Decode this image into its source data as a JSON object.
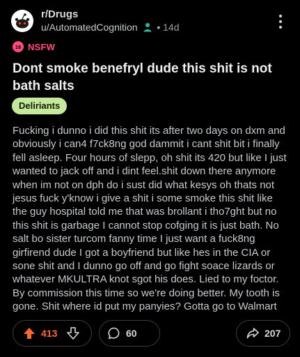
{
  "post": {
    "subreddit": "r/Drugs",
    "author": "u/AutomatedCognition",
    "age": "14d",
    "separator": "•",
    "nsfw_label": "NSFW",
    "title": "Dont smoke benefryl dude this shit is not bath salts",
    "flair": "Deliriants",
    "body": "Fucking i dunno i did this shit its after two days on dxm and obviously i can4 f7ck8ng god dammit i cant shit bit i finally fell asleep. Four hours of slepp, oh shit its 420 but like I just wanted to jack off and i dint feel.shit down there anymore when im not on dph do i sust did what kesys oh thats not jesus fuck y'know i give a shit i some smoke this shit like the guy hospital told me that was brollant i tho7ght but no this shit is garbage I cannot stop cofging it is just bath. No salt bo sister turcom fanny time I just want a fuck8ng girfirend dude I got a boyfriend but like hes in the CIA or sone shit and I dunno go off and go fight soace lizards or whatever MKULTRA knot sgot his does. Lied to my foctor. By commission this time so we're doing better. My tooth is gone. Shit where id put my panyies? Gotta go to Walmart"
  },
  "actions": {
    "score": "413",
    "comments": "60",
    "shares": "207"
  },
  "icons": {
    "avatar": "reddit-snoo-icon",
    "user": "user-status-icon",
    "more": "more-vertical-icon",
    "nsfw": "nsfw-icon",
    "upvote": "upvote-arrow-icon",
    "downvote": "downvote-arrow-icon",
    "comment": "comment-bubble-icon",
    "share": "share-arrow-icon"
  },
  "colors": {
    "background": "#000000",
    "score": "#ff6a2a",
    "nsfw": "#ff4a7a",
    "flair_bg": "#c5e89a",
    "user_icon": "#2fb99a"
  }
}
